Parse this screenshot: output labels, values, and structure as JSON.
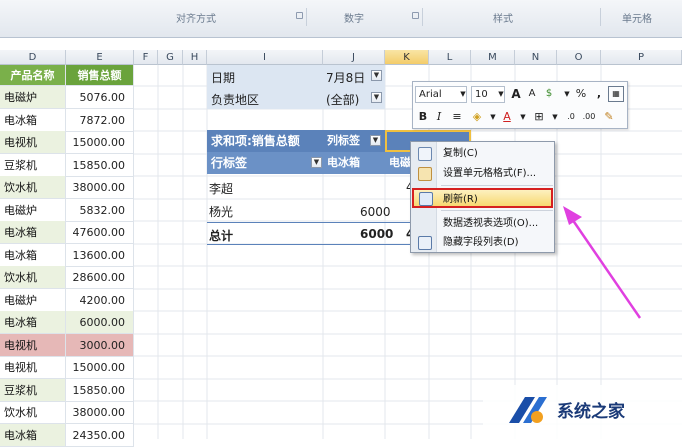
{
  "ribbon": {
    "groups": [
      "对齐方式",
      "数字",
      "样式",
      "单元格"
    ]
  },
  "columns": [
    "D",
    "E",
    "F",
    "G",
    "H",
    "I",
    "J",
    "K",
    "L",
    "M",
    "N",
    "O",
    "P"
  ],
  "sheet_header": {
    "product": "产品名称",
    "sales": "销售总额"
  },
  "rows": [
    {
      "product": "电磁炉",
      "sales": "5076.00"
    },
    {
      "product": "电冰箱",
      "sales": "7872.00"
    },
    {
      "product": "电视机",
      "sales": "15000.00"
    },
    {
      "product": "豆浆机",
      "sales": "15850.00"
    },
    {
      "product": "饮水机",
      "sales": "38000.00"
    },
    {
      "product": "电磁炉",
      "sales": "5832.00"
    },
    {
      "product": "电冰箱",
      "sales": "47600.00"
    },
    {
      "product": "电冰箱",
      "sales": "13600.00"
    },
    {
      "product": "饮水机",
      "sales": "28600.00"
    },
    {
      "product": "电磁炉",
      "sales": "4200.00"
    },
    {
      "product": "电冰箱",
      "sales": "6000.00"
    },
    {
      "product": "电视机",
      "sales": "3000.00"
    },
    {
      "product": "电视机",
      "sales": "15000.00"
    },
    {
      "product": "豆浆机",
      "sales": "15850.00"
    },
    {
      "product": "饮水机",
      "sales": "38000.00"
    },
    {
      "product": "电冰箱",
      "sales": "24350.00"
    }
  ],
  "pivot": {
    "date_label": "日期",
    "date_value": "7月8日",
    "region_label": "负责地区",
    "region_value": "(全部)",
    "sum_label": "求和项:销售总额",
    "col_label": "列标签",
    "row_label": "行标签",
    "col1": "电冰箱",
    "col2": "电磁",
    "names": [
      "李超",
      "杨光"
    ],
    "yang_value": "6000",
    "total_label": "总计",
    "total_value": "6000",
    "li_partial": "4",
    "total_partial": "4"
  },
  "mini_toolbar": {
    "font": "Arial",
    "size": "10",
    "bold": "B",
    "italic": "I",
    "percent": "%",
    "comma": ","
  },
  "context_menu": {
    "items": [
      "复制(C)",
      "设置单元格格式(F)...",
      "刷新(R)",
      "数据透视表选项(O)...",
      "隐藏字段列表(D)"
    ]
  },
  "watermark": {
    "text": "系统之家"
  },
  "colors": {
    "accent": "#5b82ba",
    "highlight_border": "#d62020",
    "arrow": "#e040e0",
    "header_green": "#6aa33c"
  }
}
